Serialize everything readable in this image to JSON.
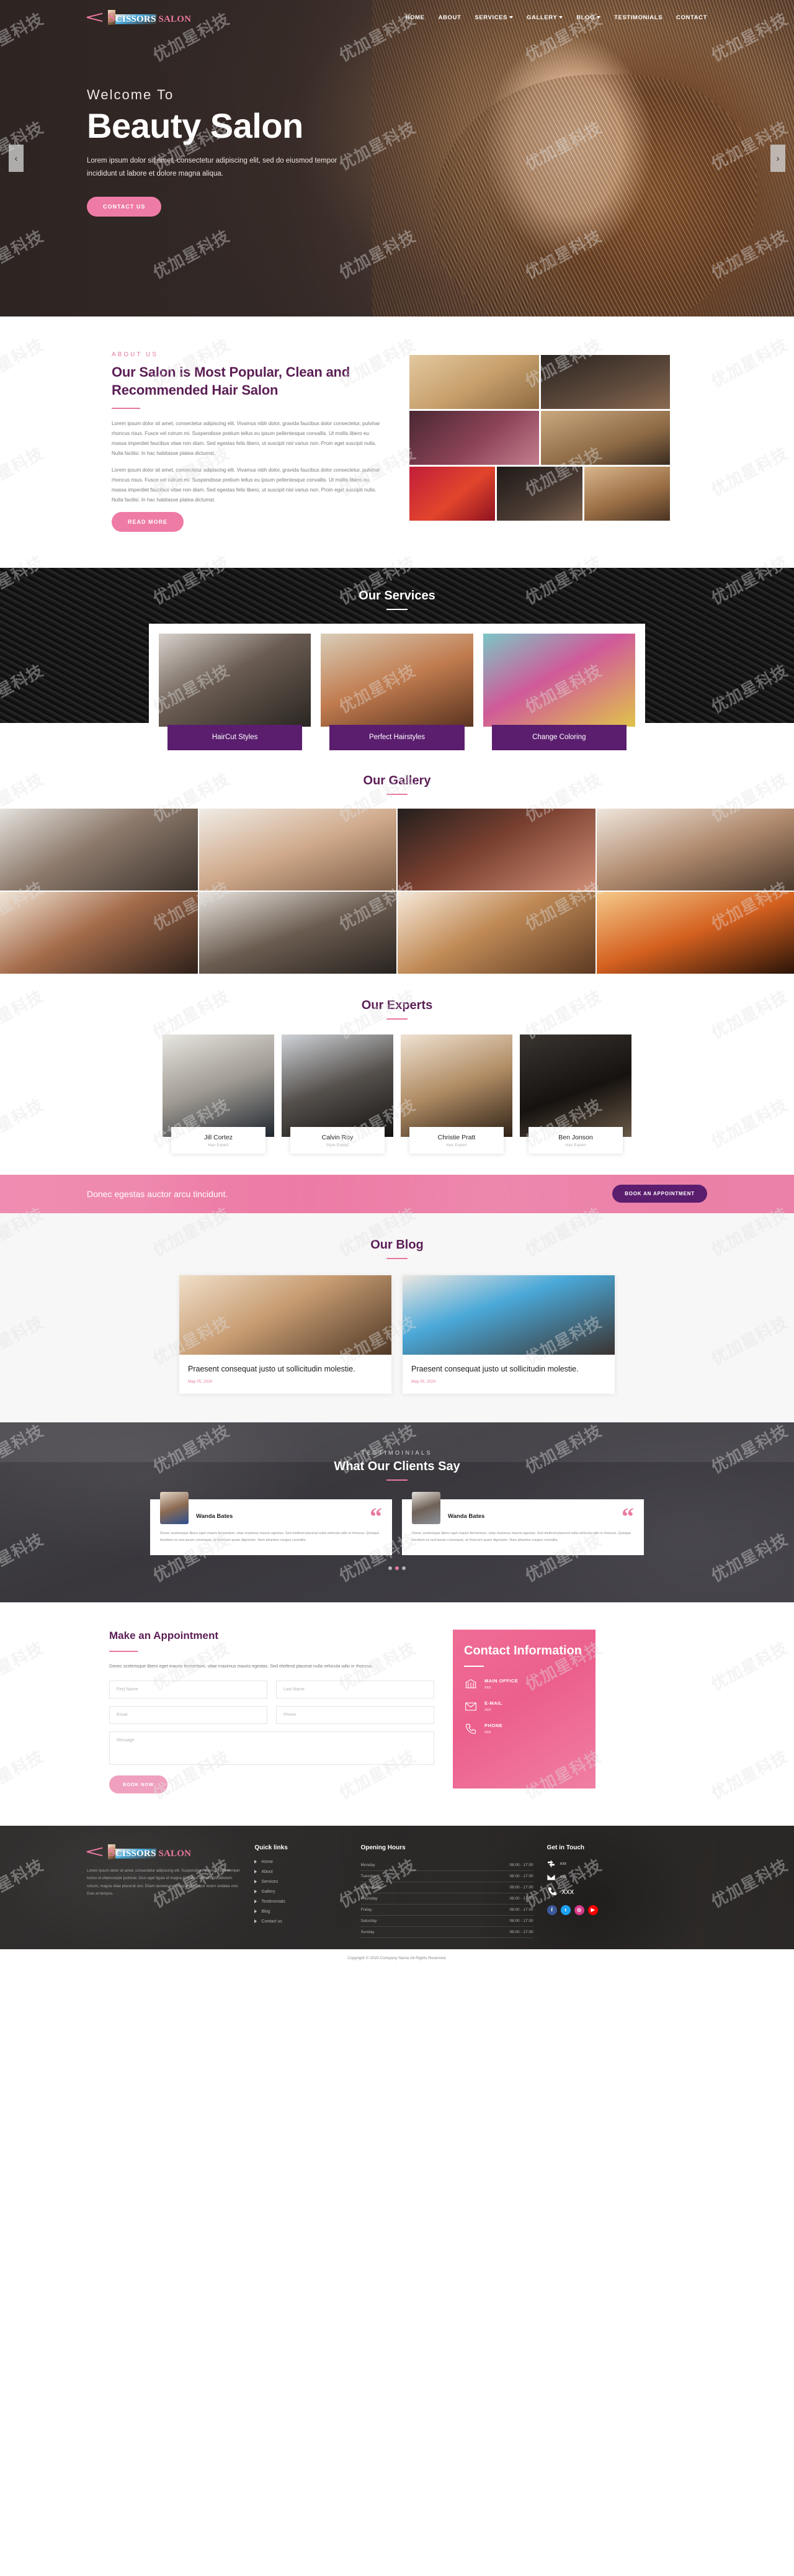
{
  "brand": {
    "part1": "S",
    "part2": "CISSORS",
    "part3": " SALON",
    "icon": "scissors-icon"
  },
  "nav": {
    "items": [
      {
        "label": "HOME",
        "dropdown": false
      },
      {
        "label": "ABOUT",
        "dropdown": false
      },
      {
        "label": "SERVICES",
        "dropdown": true
      },
      {
        "label": "GALLERY",
        "dropdown": true
      },
      {
        "label": "BLOG",
        "dropdown": true
      },
      {
        "label": "TESTIMONIALS",
        "dropdown": false
      },
      {
        "label": "CONTACT",
        "dropdown": false
      }
    ]
  },
  "hero": {
    "welcome": "Welcome To",
    "title": "Beauty Salon",
    "subtitle": "Lorem ipsum dolor sit amet, consectetur adipiscing elit, sed do eiusmod tempor incididunt ut labore et dolore magna aliqua.",
    "cta": "CONTACT US",
    "prev_icon": "chevron-left-icon",
    "next_icon": "chevron-right-icon"
  },
  "about": {
    "kicker": "ABOUT US",
    "heading": "Our Salon is Most Popular, Clean and Recommended Hair Salon",
    "p1": "Lorem ipsum dolor sit amet, consectetur adipiscing elit. Vivamus nibh dolor, gravida faucibus dolor consectetur, pulvinar rhoncus risus. Fusce vel rutrum mi. Suspendisse pretium tellus eu ipsum pellentesque convallis. Ut mollis libero eu massa imperdiet faucibus vitae non diam. Sed egestas felis libero, ut suscipit nisl varius non. Proin eget suscipit nulla. Nulla facilisi. In hac habitasse platea dictumst.",
    "p2": "Lorem ipsum dolor sit amet, consectetur adipiscing elit. Vivamus nibh dolor, gravida faucibus dolor consectetur, pulvinar rhoncus risus. Fusce vel rutrum mi. Suspendisse pretium tellus eu ipsum pellentesque convallis. Ut mollis libero eu massa imperdiet faucibus vitae non diam. Sed egestas felis libero, ut suscipit nisl varius non. Proin eget suscipit nulla. Nulla facilisi. In hac habitasse platea dictumst.",
    "cta": "READ MORE"
  },
  "services": {
    "title": "Our Services",
    "cards": [
      {
        "label": "HairCut Styles"
      },
      {
        "label": "Perfect Hairstyles"
      },
      {
        "label": "Change Coloring"
      }
    ]
  },
  "gallery": {
    "title": "Our Gallery"
  },
  "experts": {
    "title": "Our Experts",
    "members": [
      {
        "name": "Jill Cortez",
        "role": "Hair Expert"
      },
      {
        "name": "Calvin Roy",
        "role": "Style Expert"
      },
      {
        "name": "Christie Pratt",
        "role": "Hair Expert"
      },
      {
        "name": "Ben Jonson",
        "role": "Hair Expert"
      }
    ]
  },
  "banner": {
    "text": "Donec egestas auctor arcu tincidunt.",
    "cta": "BOOK AN APPOINTMENT"
  },
  "blog": {
    "title": "Our Blog",
    "posts": [
      {
        "title": "Praesent consequat justo ut sollicitudin molestie.",
        "date": "May 05, 2020"
      },
      {
        "title": "Praesent consequat justo ut sollicitudin molestie.",
        "date": "May 05, 2020"
      }
    ]
  },
  "testimonials": {
    "kicker": "TESTIMOINIALS",
    "title": "What Our Clients Say",
    "quote_icon": "quote-icon",
    "items": [
      {
        "name": "Wanda Bates",
        "text": "Donec scelerisque libero eget mauris fermentum, vitae maximus mauris egestas. Sed eleifend placerat nulla vehicula odio in rhoncus. Quisque tincidunt ex sed ipsum consequat, at rhoncum quam dignissim. Nam pharetra congue convallis."
      },
      {
        "name": "Wanda Bates",
        "text": "Donec scelerisque libero eget mauris fermentum, vitae maximus mauris egestas. Sed eleifend placerat nulla vehicula odio in rhoncus. Quisque tincidunt ex sed ipsum consequat, at rhoncum quam dignissim. Nam pharetra congue convallis."
      }
    ],
    "dots": 3,
    "active_dot": 2
  },
  "appointment": {
    "title": "Make an Appointment",
    "desc": "Donec scelerisque libero eget mauris fermentum, vitae maximus mauris egestas. Sed eleifend placerat nulla vehicula odio in rhoncus.",
    "fields": {
      "first_name": "First Name",
      "last_name": "Last Name",
      "email": "Email",
      "phone": "Phone",
      "message": "Message"
    },
    "cta": "BOOK NOW"
  },
  "contact_info": {
    "title": "Contact Information",
    "items": [
      {
        "icon": "bank-icon",
        "label": "MAIN OFFICE",
        "value": "xxx"
      },
      {
        "icon": "envelope-icon",
        "label": "E-MAIL",
        "value": "xxx"
      },
      {
        "icon": "phone-icon",
        "label": "PHONE",
        "value": "xxx"
      }
    ]
  },
  "footer": {
    "about_text": "Lorem ipsum dolor sit amet, consectetur adipiscing elit. Suspendisse potenti. Nam semper lectus ut ullamcorper pulvinar. Duis eget ligula id magna id finibus ultrices. Vestibulum rutrum, magna vitae placerat orci. Etiam laoreet erat feugiat at tempor lorem sodales non. Duis et tempus.",
    "quick_links_title": "Quick links",
    "quick_links": [
      "Home",
      "About",
      "Services",
      "Gallery",
      "Testimonials",
      "Blog",
      "Contact us"
    ],
    "hours_title": "Opening Hours",
    "hours": [
      {
        "day": "Monday",
        "time": "08:00 - 17:00"
      },
      {
        "day": "Tuesday",
        "time": "08:00 - 17:00"
      },
      {
        "day": "Wednesday",
        "time": "08:00 - 17:00"
      },
      {
        "day": "Thursday",
        "time": "08:00 - 17:00"
      },
      {
        "day": "Friday",
        "time": "08:00 - 17:00"
      },
      {
        "day": "Saturday",
        "time": "08:00 - 17:00"
      },
      {
        "day": "Sunday",
        "time": "08:00 - 17:00"
      }
    ],
    "touch_title": "Get in Touch",
    "address": "xxx",
    "email": "xxx",
    "phone": "xxx",
    "socials": [
      {
        "name": "facebook-icon",
        "glyph": "f",
        "color": "#3b5998"
      },
      {
        "name": "twitter-icon",
        "glyph": "t",
        "color": "#1da1f2"
      },
      {
        "name": "instagram-icon",
        "glyph": "◎",
        "color": "#d63a87"
      },
      {
        "name": "youtube-icon",
        "glyph": "▶",
        "color": "#ff0000"
      }
    ],
    "copyright": "Copyright © 2020.Company Name All Rights Reserved."
  },
  "watermark": {
    "text": "优加星科技"
  },
  "colors": {
    "pink": "#e8799f",
    "purple": "#5b1e6e",
    "dark_purple": "#5b1e55",
    "hot_pink": "#ec5f8c"
  }
}
